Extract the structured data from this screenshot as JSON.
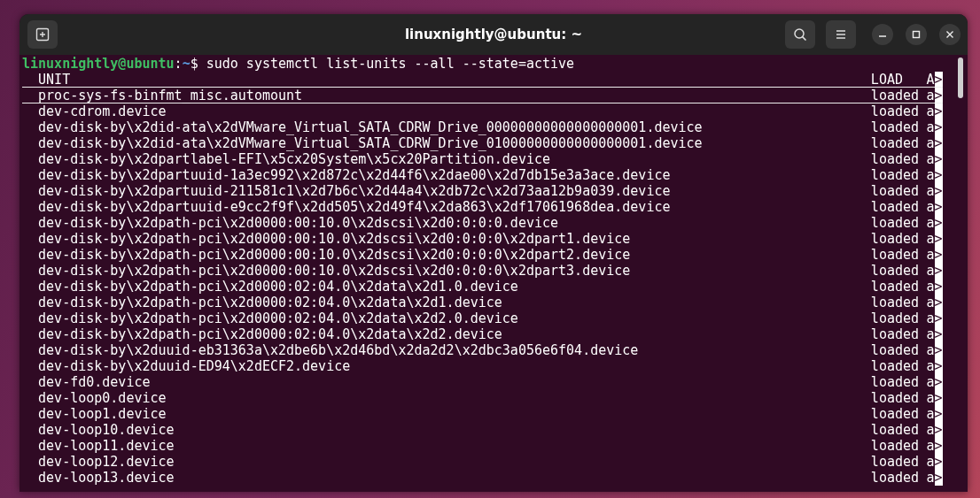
{
  "window": {
    "title": "linuxnightly@ubuntu: ~"
  },
  "prompt": {
    "user": "linuxnightly@ubuntu",
    "separator": ":",
    "path": "~",
    "symbol": "$",
    "command": "sudo systemctl list-units --all --state=active"
  },
  "table": {
    "header": {
      "unit": "UNIT",
      "load": "LOAD",
      "active": "A",
      "marker": ">",
      "underlined": true
    },
    "rows": [
      {
        "unit": "proc-sys-fs-binfmt_misc.automount",
        "load": "loaded",
        "active": "a",
        "marker": ">",
        "underlined": true
      },
      {
        "unit": "dev-cdrom.device",
        "load": "loaded",
        "active": "a",
        "marker": ">",
        "underlined": false
      },
      {
        "unit": "dev-disk-by\\x2did-ata\\x2dVMware_Virtual_SATA_CDRW_Drive_00000000000000000001.device",
        "load": "loaded",
        "active": "a",
        "marker": ">",
        "underlined": false
      },
      {
        "unit": "dev-disk-by\\x2did-ata\\x2dVMware_Virtual_SATA_CDRW_Drive_01000000000000000001.device",
        "load": "loaded",
        "active": "a",
        "marker": ">",
        "underlined": false
      },
      {
        "unit": "dev-disk-by\\x2dpartlabel-EFI\\x5cx20System\\x5cx20Partition.device",
        "load": "loaded",
        "active": "a",
        "marker": ">",
        "underlined": false
      },
      {
        "unit": "dev-disk-by\\x2dpartuuid-1a3ec992\\x2d872c\\x2d44f6\\x2dae00\\x2d7db15e3a3ace.device",
        "load": "loaded",
        "active": "a",
        "marker": ">",
        "underlined": false
      },
      {
        "unit": "dev-disk-by\\x2dpartuuid-211581c1\\x2d7b6c\\x2d44a4\\x2db72c\\x2d73aa12b9a039.device",
        "load": "loaded",
        "active": "a",
        "marker": ">",
        "underlined": false
      },
      {
        "unit": "dev-disk-by\\x2dpartuuid-e9cc2f9f\\x2dd505\\x2d49f4\\x2da863\\x2df17061968dea.device",
        "load": "loaded",
        "active": "a",
        "marker": ">",
        "underlined": false
      },
      {
        "unit": "dev-disk-by\\x2dpath-pci\\x2d0000:00:10.0\\x2dscsi\\x2d0:0:0:0.device",
        "load": "loaded",
        "active": "a",
        "marker": ">",
        "underlined": false
      },
      {
        "unit": "dev-disk-by\\x2dpath-pci\\x2d0000:00:10.0\\x2dscsi\\x2d0:0:0:0\\x2dpart1.device",
        "load": "loaded",
        "active": "a",
        "marker": ">",
        "underlined": false
      },
      {
        "unit": "dev-disk-by\\x2dpath-pci\\x2d0000:00:10.0\\x2dscsi\\x2d0:0:0:0\\x2dpart2.device",
        "load": "loaded",
        "active": "a",
        "marker": ">",
        "underlined": false
      },
      {
        "unit": "dev-disk-by\\x2dpath-pci\\x2d0000:00:10.0\\x2dscsi\\x2d0:0:0:0\\x2dpart3.device",
        "load": "loaded",
        "active": "a",
        "marker": ">",
        "underlined": false
      },
      {
        "unit": "dev-disk-by\\x2dpath-pci\\x2d0000:02:04.0\\x2data\\x2d1.0.device",
        "load": "loaded",
        "active": "a",
        "marker": ">",
        "underlined": false
      },
      {
        "unit": "dev-disk-by\\x2dpath-pci\\x2d0000:02:04.0\\x2data\\x2d1.device",
        "load": "loaded",
        "active": "a",
        "marker": ">",
        "underlined": false
      },
      {
        "unit": "dev-disk-by\\x2dpath-pci\\x2d0000:02:04.0\\x2data\\x2d2.0.device",
        "load": "loaded",
        "active": "a",
        "marker": ">",
        "underlined": false
      },
      {
        "unit": "dev-disk-by\\x2dpath-pci\\x2d0000:02:04.0\\x2data\\x2d2.device",
        "load": "loaded",
        "active": "a",
        "marker": ">",
        "underlined": false
      },
      {
        "unit": "dev-disk-by\\x2duuid-eb31363a\\x2dbe6b\\x2d46bd\\x2da2d2\\x2dbc3a056e6f04.device",
        "load": "loaded",
        "active": "a",
        "marker": ">",
        "underlined": false
      },
      {
        "unit": "dev-disk-by\\x2duuid-ED94\\x2dECF2.device",
        "load": "loaded",
        "active": "a",
        "marker": ">",
        "underlined": false
      },
      {
        "unit": "dev-fd0.device",
        "load": "loaded",
        "active": "a",
        "marker": ">",
        "underlined": false
      },
      {
        "unit": "dev-loop0.device",
        "load": "loaded",
        "active": "a",
        "marker": ">",
        "underlined": false
      },
      {
        "unit": "dev-loop1.device",
        "load": "loaded",
        "active": "a",
        "marker": ">",
        "underlined": false
      },
      {
        "unit": "dev-loop10.device",
        "load": "loaded",
        "active": "a",
        "marker": ">",
        "underlined": false
      },
      {
        "unit": "dev-loop11.device",
        "load": "loaded",
        "active": "a",
        "marker": ">",
        "underlined": false
      },
      {
        "unit": "dev-loop12.device",
        "load": "loaded",
        "active": "a",
        "marker": ">",
        "underlined": false
      },
      {
        "unit": "dev-loop13.device",
        "load": "loaded",
        "active": "a",
        "marker": ">",
        "underlined": false
      }
    ]
  }
}
